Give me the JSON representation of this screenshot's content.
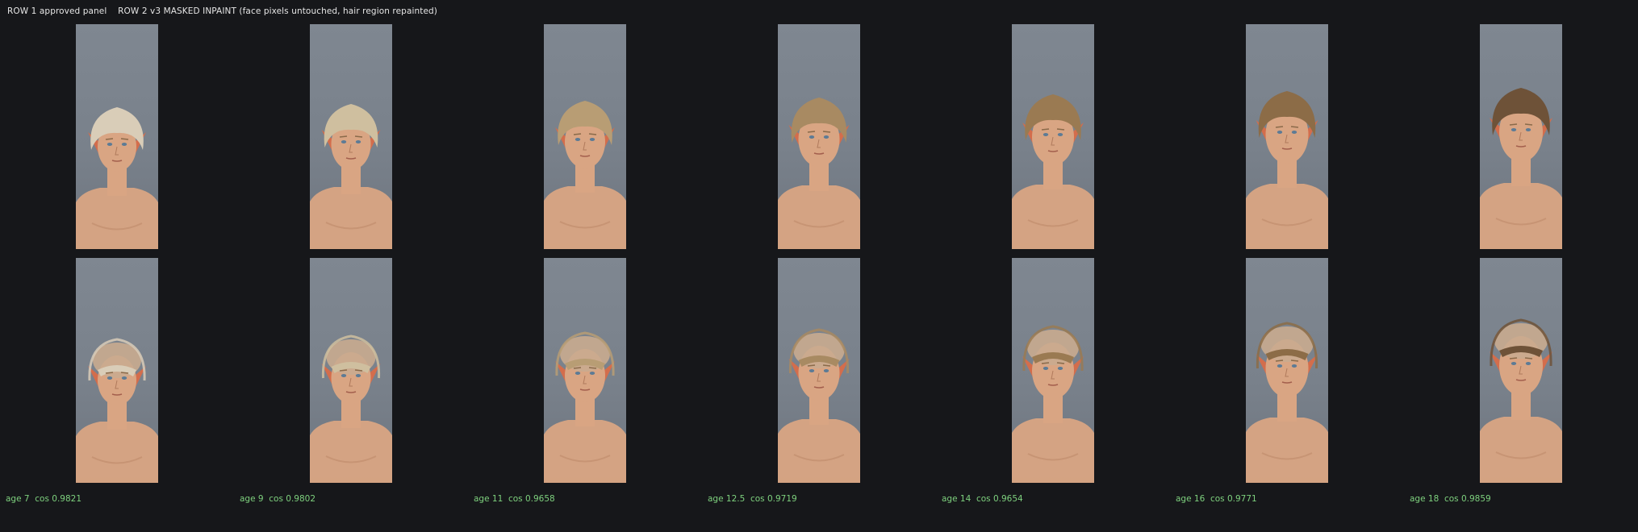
{
  "header": {
    "row1_label": "ROW 1 approved panel",
    "row2_label": "ROW 2 v3 MASKED INPAINT (face pixels untouched, hair region repainted)"
  },
  "columns": [
    {
      "age": "age 7",
      "cos": "cos 0.9821",
      "hair": "#d9cdb8"
    },
    {
      "age": "age 9",
      "cos": "cos 0.9802",
      "hair": "#cfbf9f"
    },
    {
      "age": "age 11",
      "cos": "cos 0.9658",
      "hair": "#b89d74"
    },
    {
      "age": "age 12.5",
      "cos": "cos 0.9719",
      "hair": "#a88a62"
    },
    {
      "age": "age 14",
      "cos": "cos 0.9654",
      "hair": "#9a7a52"
    },
    {
      "age": "age 16",
      "cos": "cos 0.9771",
      "hair": "#8c6c47"
    },
    {
      "age": "age 18",
      "cos": "cos 0.9859",
      "hair": "#6e5238"
    }
  ],
  "colors": {
    "background": "#16171a",
    "caption": "#7ed17e",
    "header": "#e6e6e6",
    "skin": "#d9a583",
    "ear": "#d36d4c",
    "inpaint_cap": "#c9ab8f"
  }
}
